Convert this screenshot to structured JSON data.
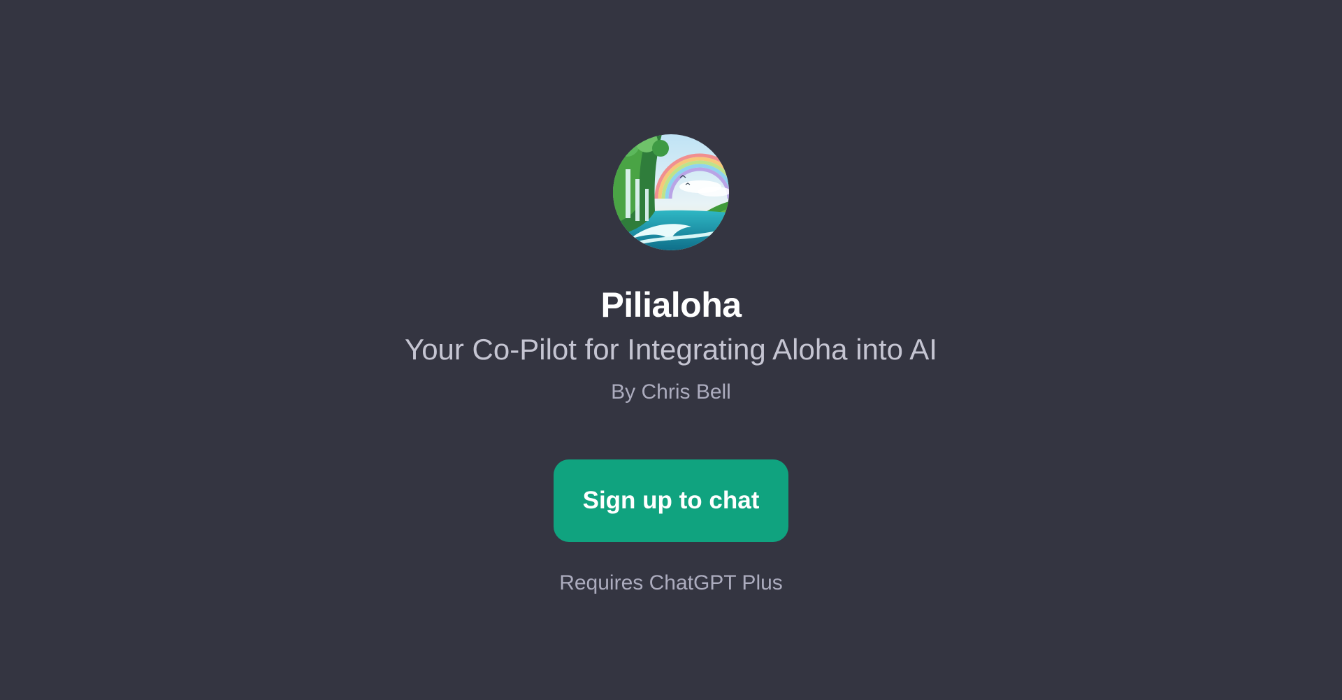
{
  "gpt": {
    "avatar_icon": "tropical-landscape-avatar",
    "name": "Pilialoha",
    "description": "Your Co-Pilot for Integrating Aloha into AI",
    "author": "By Chris Bell"
  },
  "actions": {
    "signup_label": "Sign up to chat"
  },
  "footer": {
    "requirement": "Requires ChatGPT Plus"
  },
  "colors": {
    "background": "#343541",
    "button": "#10a37f",
    "title": "#ffffff",
    "subtitle": "#c5c5d2",
    "muted": "#acacbe"
  }
}
